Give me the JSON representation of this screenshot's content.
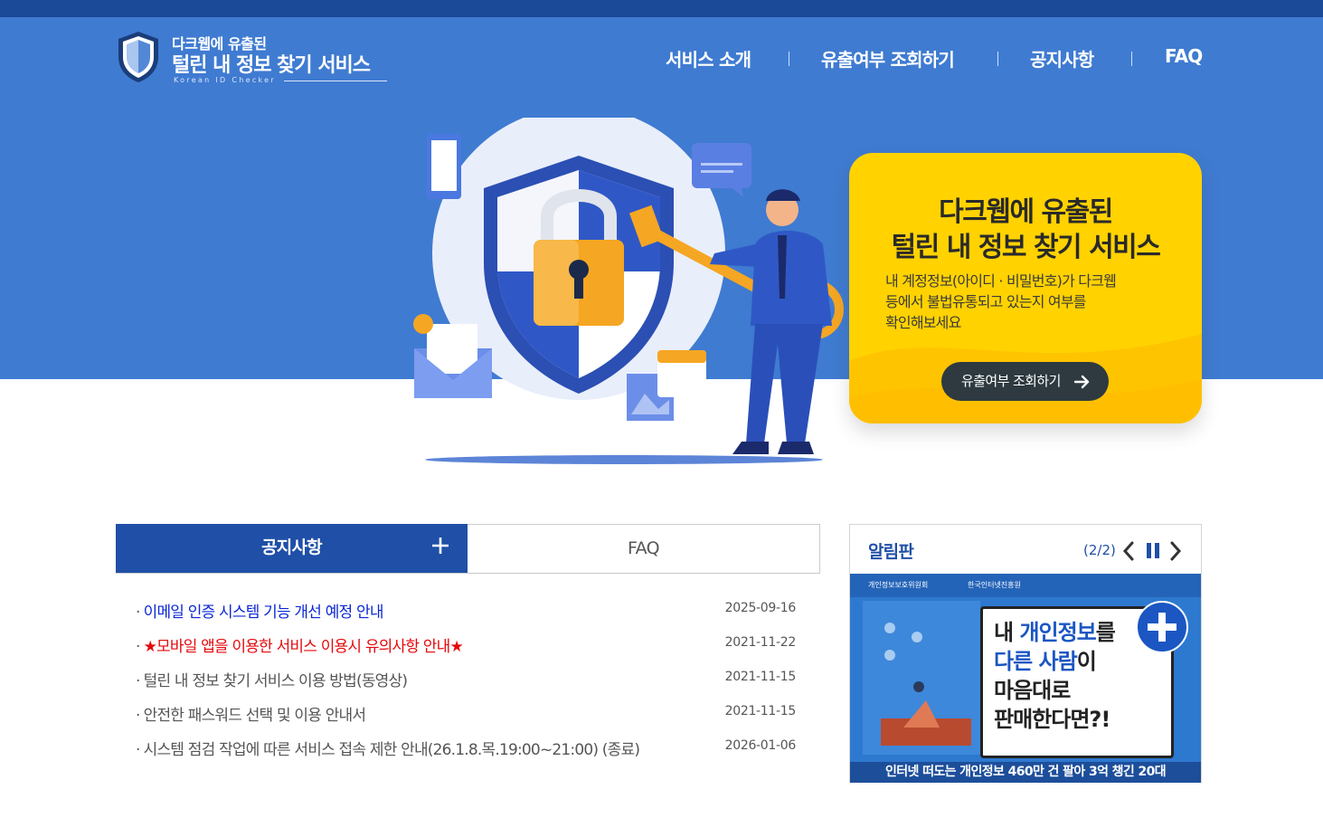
{
  "logo": {
    "line1": "다크웹에 유출된",
    "line2": "털린 내 정보 찾기 서비스",
    "line3": "Korean ID Checker"
  },
  "nav": {
    "items": [
      "서비스 소개",
      "유출여부 조회하기",
      "공지사항",
      "FAQ"
    ]
  },
  "hero": {
    "title_line1": "다크웹에 유출된",
    "title_line2": "털린 내 정보 찾기 서비스",
    "desc_line1": "내 계정정보(아이디 · 비밀번호)가 다크웹",
    "desc_line2": "등에서 불법유통되고 있는지 여부를",
    "desc_line3": "확인해보세요",
    "button_label": "유출여부 조회하기"
  },
  "tabs": {
    "notice": "공지사항",
    "faq": "FAQ"
  },
  "notices": [
    {
      "bullet": "·",
      "title": "이메일 인증 시스템 기능 개선 예정 안내",
      "date": "2025-09-16"
    },
    {
      "bullet": "·",
      "title": "★모바일 앱을 이용한 서비스 이용시 유의사항 안내★",
      "date": "2021-11-22"
    },
    {
      "bullet": "·",
      "title": "털린 내 정보 찾기 서비스 이용 방법(동영상)",
      "date": "2021-11-15"
    },
    {
      "bullet": "·",
      "title": "안전한 패스워드 선택 및 이용 안내서",
      "date": "2021-11-15"
    },
    {
      "bullet": "·",
      "title": "시스템 점검 작업에 따른 서비스 접속 제한 안내(26.1.8.목.19:00~21:00) (종료)",
      "date": "2026-01-06"
    }
  ],
  "board": {
    "title": "알림판",
    "count": "(2/2)",
    "banner": {
      "org1": "개인정보보호위원회",
      "org2": "한국인터넷진흥원",
      "line1_a": "내 ",
      "line1_b": "개인정보",
      "line1_c": "를",
      "line2_a": "다른 사람",
      "line2_b": "이",
      "line3": "마음대로",
      "line4": "판매한다면?!",
      "bottom": "인터넷 떠도는 개인정보 460만 건 팔아 3억 챙긴 20대"
    }
  },
  "colors": {
    "header_blue": "#3f7bd1",
    "topbar": "#1b4a98",
    "card_yellow": "#ffd200",
    "tab_active": "#1f4fa7",
    "notice_blue": "#0b27d4",
    "notice_red": "#e4090c"
  },
  "icons": [
    "shield-logo-icon",
    "plus-icon",
    "arrow-right-icon",
    "chevron-left-icon",
    "pause-icon",
    "chevron-right-icon",
    "padlock-icon",
    "key-icon"
  ]
}
